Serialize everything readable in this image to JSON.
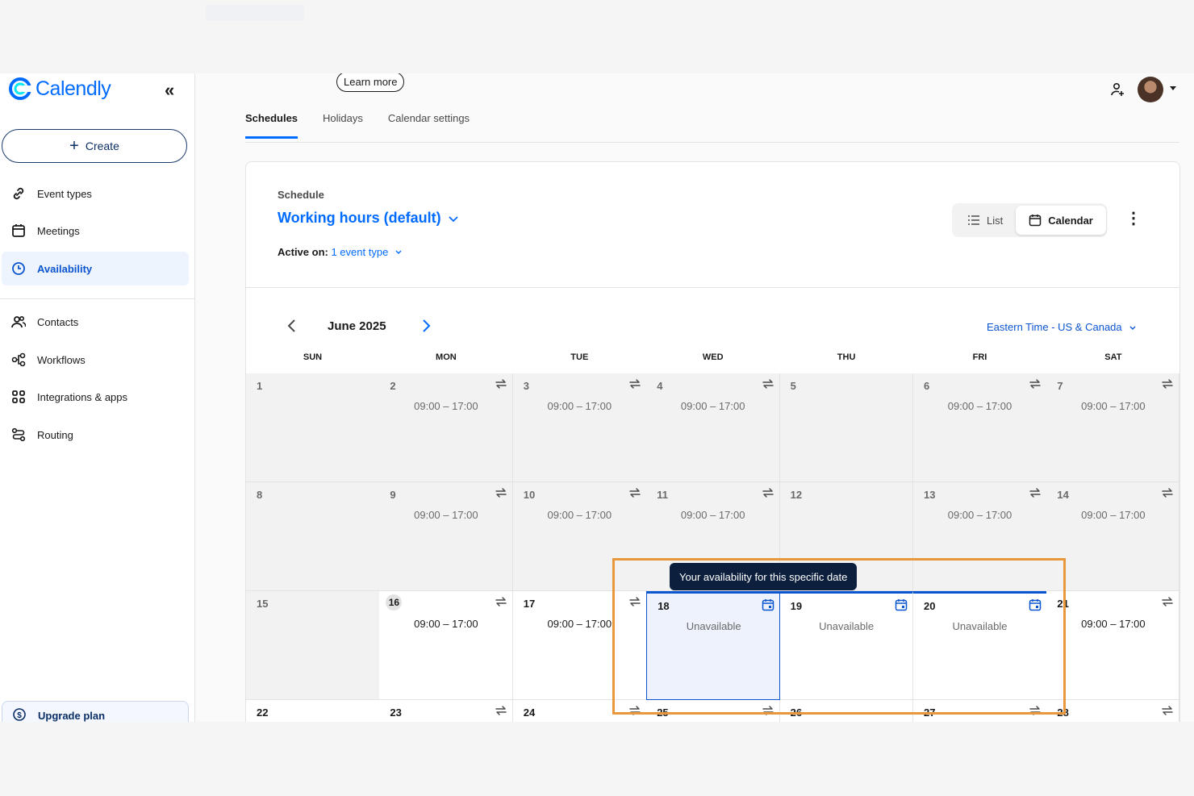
{
  "brand": {
    "name": "Calendly",
    "color": "#006bff"
  },
  "sidebar": {
    "create_label": "Create",
    "items": [
      {
        "label": "Event types",
        "icon": "link-icon"
      },
      {
        "label": "Meetings",
        "icon": "calendar-icon"
      },
      {
        "label": "Availability",
        "icon": "clock-icon",
        "active": true
      },
      {
        "label": "Contacts",
        "icon": "contacts-icon"
      },
      {
        "label": "Workflows",
        "icon": "workflow-icon"
      },
      {
        "label": "Integrations & apps",
        "icon": "grid-icon"
      },
      {
        "label": "Routing",
        "icon": "routing-icon"
      }
    ],
    "upgrade_label": "Upgrade plan"
  },
  "header": {
    "learn_more": "Learn more"
  },
  "tabs": [
    "Schedules",
    "Holidays",
    "Calendar settings"
  ],
  "schedule": {
    "label": "Schedule",
    "title": "Working hours (default)",
    "active_on_label": "Active on:",
    "active_on_value": "1 event type"
  },
  "view_toggle": {
    "list": "List",
    "calendar": "Calendar"
  },
  "calendar": {
    "month": "June 2025",
    "timezone": "Eastern Time - US & Canada",
    "days_of_week": [
      "SUN",
      "MON",
      "TUE",
      "WED",
      "THU",
      "FRI",
      "SAT"
    ],
    "weeks": [
      [
        {
          "day": "1",
          "past": true
        },
        {
          "day": "2",
          "past": true,
          "hours": "09:00 – 17:00",
          "repeat": true
        },
        {
          "day": "3",
          "past": true,
          "hours": "09:00 – 17:00",
          "repeat": true
        },
        {
          "day": "4",
          "past": true,
          "hours": "09:00 – 17:00",
          "repeat": true
        },
        {
          "day": "5",
          "past": true
        },
        {
          "day": "6",
          "past": true,
          "hours": "09:00 – 17:00",
          "repeat": true
        },
        {
          "day": "7",
          "past": true,
          "hours": "09:00 – 17:00",
          "repeat": true
        }
      ],
      [
        {
          "day": "8",
          "past": true
        },
        {
          "day": "9",
          "past": true,
          "hours": "09:00 – 17:00",
          "repeat": true
        },
        {
          "day": "10",
          "past": true,
          "hours": "09:00 – 17:00",
          "repeat": true
        },
        {
          "day": "11",
          "past": true,
          "hours": "09:00 – 17:00",
          "repeat": true
        },
        {
          "day": "12",
          "past": true
        },
        {
          "day": "13",
          "past": true,
          "hours": "09:00 – 17:00",
          "repeat": true
        },
        {
          "day": "14",
          "past": true,
          "hours": "09:00 – 17:00",
          "repeat": true
        }
      ],
      [
        {
          "day": "15",
          "past": true
        },
        {
          "day": "16",
          "today": true,
          "hours": "09:00 – 17:00",
          "repeat": true
        },
        {
          "day": "17",
          "hours": "09:00 – 17:00",
          "repeat": true
        },
        {
          "day": "18",
          "unavailable": "Unavailable",
          "override": true,
          "selected": true
        },
        {
          "day": "19",
          "unavailable": "Unavailable",
          "override": true
        },
        {
          "day": "20",
          "unavailable": "Unavailable",
          "override": true
        },
        {
          "day": "21",
          "hours": "09:00 – 17:00",
          "repeat": true
        }
      ],
      [
        {
          "day": "22"
        },
        {
          "day": "23",
          "repeat": true
        },
        {
          "day": "24",
          "repeat": true
        },
        {
          "day": "25",
          "repeat": true
        },
        {
          "day": "26"
        },
        {
          "day": "27",
          "repeat": true
        },
        {
          "day": "28",
          "repeat": true
        }
      ]
    ]
  },
  "tooltip": "Your availability for this specific date",
  "colors": {
    "accent": "#006bff",
    "highlight": "#e8973a",
    "tooltip_bg": "#0c1f3d"
  }
}
